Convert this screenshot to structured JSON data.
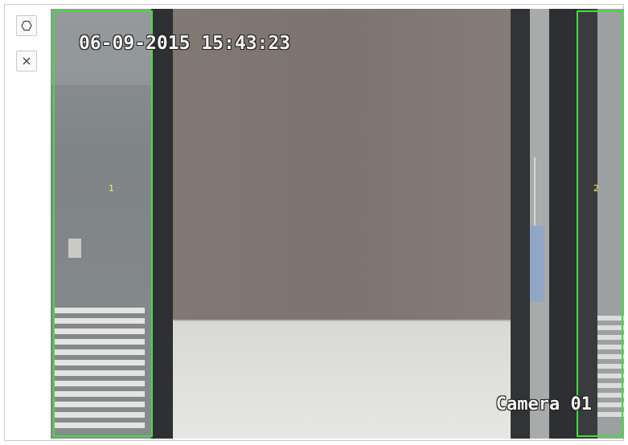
{
  "toolbar": {
    "buttons": [
      {
        "name": "draw-area-button",
        "icon": "hexagon-icon"
      },
      {
        "name": "clear-area-button",
        "icon": "close-icon"
      }
    ]
  },
  "video": {
    "timestamp": "06-09-2015 15:43:23",
    "camera_label": "Camera 01",
    "zones": [
      {
        "label": "1"
      },
      {
        "label": "2"
      }
    ],
    "zone_color": "#3ee03a",
    "zone_label_color": "#f2f24a"
  }
}
